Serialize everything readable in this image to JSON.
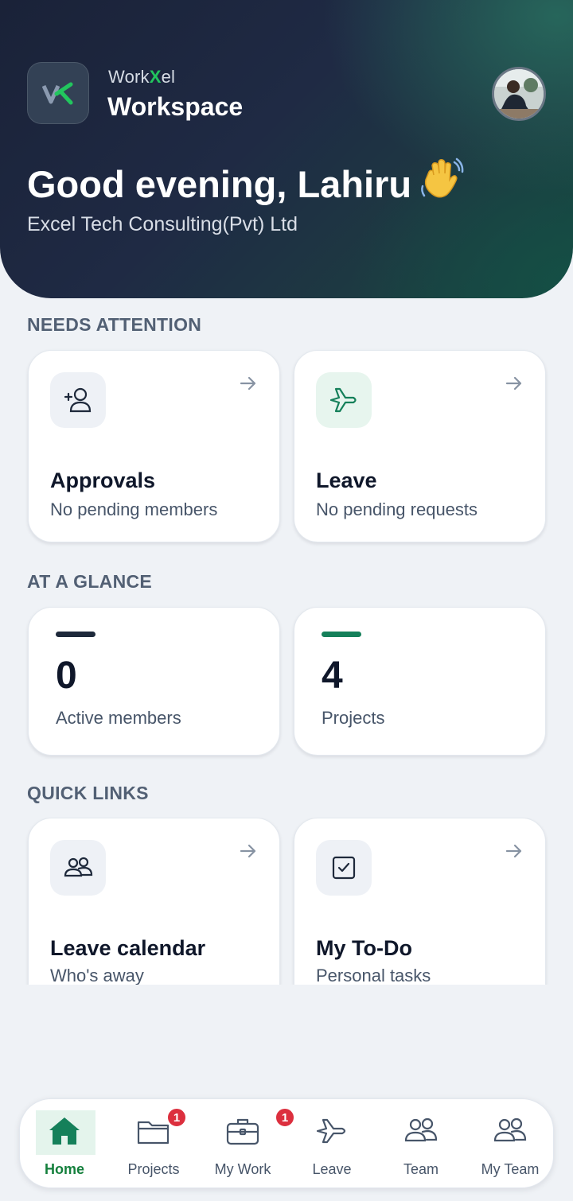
{
  "header": {
    "brand_prefix": "Work",
    "brand_x": "X",
    "brand_suffix": "el",
    "brand_title": "Workspace",
    "greeting": "Good evening, Lahiru",
    "company": "Excel Tech Consulting(Pvt) Ltd"
  },
  "needs_attention": {
    "title": "NEEDS ATTENTION",
    "cards": [
      {
        "title": "Approvals",
        "subtitle": "No pending members",
        "icon": "person-add-icon"
      },
      {
        "title": "Leave",
        "subtitle": "No pending requests",
        "icon": "airplane-icon"
      }
    ]
  },
  "at_a_glance": {
    "title": "AT A GLANCE",
    "stats": [
      {
        "value": "0",
        "label": "Active members",
        "accent": "#1e293b"
      },
      {
        "value": "4",
        "label": "Projects",
        "accent": "#15805a"
      }
    ]
  },
  "quick_links": {
    "title": "QUICK LINKS",
    "cards": [
      {
        "title": "Leave calendar",
        "subtitle": "Who's away",
        "icon": "people-icon"
      },
      {
        "title": "My To-Do",
        "subtitle": "Personal tasks",
        "icon": "checkbox-icon"
      }
    ]
  },
  "nav": {
    "items": [
      {
        "label": "Home",
        "icon": "home-icon",
        "active": true
      },
      {
        "label": "Projects",
        "icon": "folder-icon",
        "badge": "1"
      },
      {
        "label": "My Work",
        "icon": "briefcase-icon",
        "badge": "1"
      },
      {
        "label": "Leave",
        "icon": "airplane-icon"
      },
      {
        "label": "Team",
        "icon": "people-icon"
      },
      {
        "label": "My Team",
        "icon": "people-icon"
      }
    ]
  },
  "colors": {
    "accent_green": "#15803d",
    "badge_red": "#dc2f3e",
    "hero_dark": "#1f2a44"
  }
}
